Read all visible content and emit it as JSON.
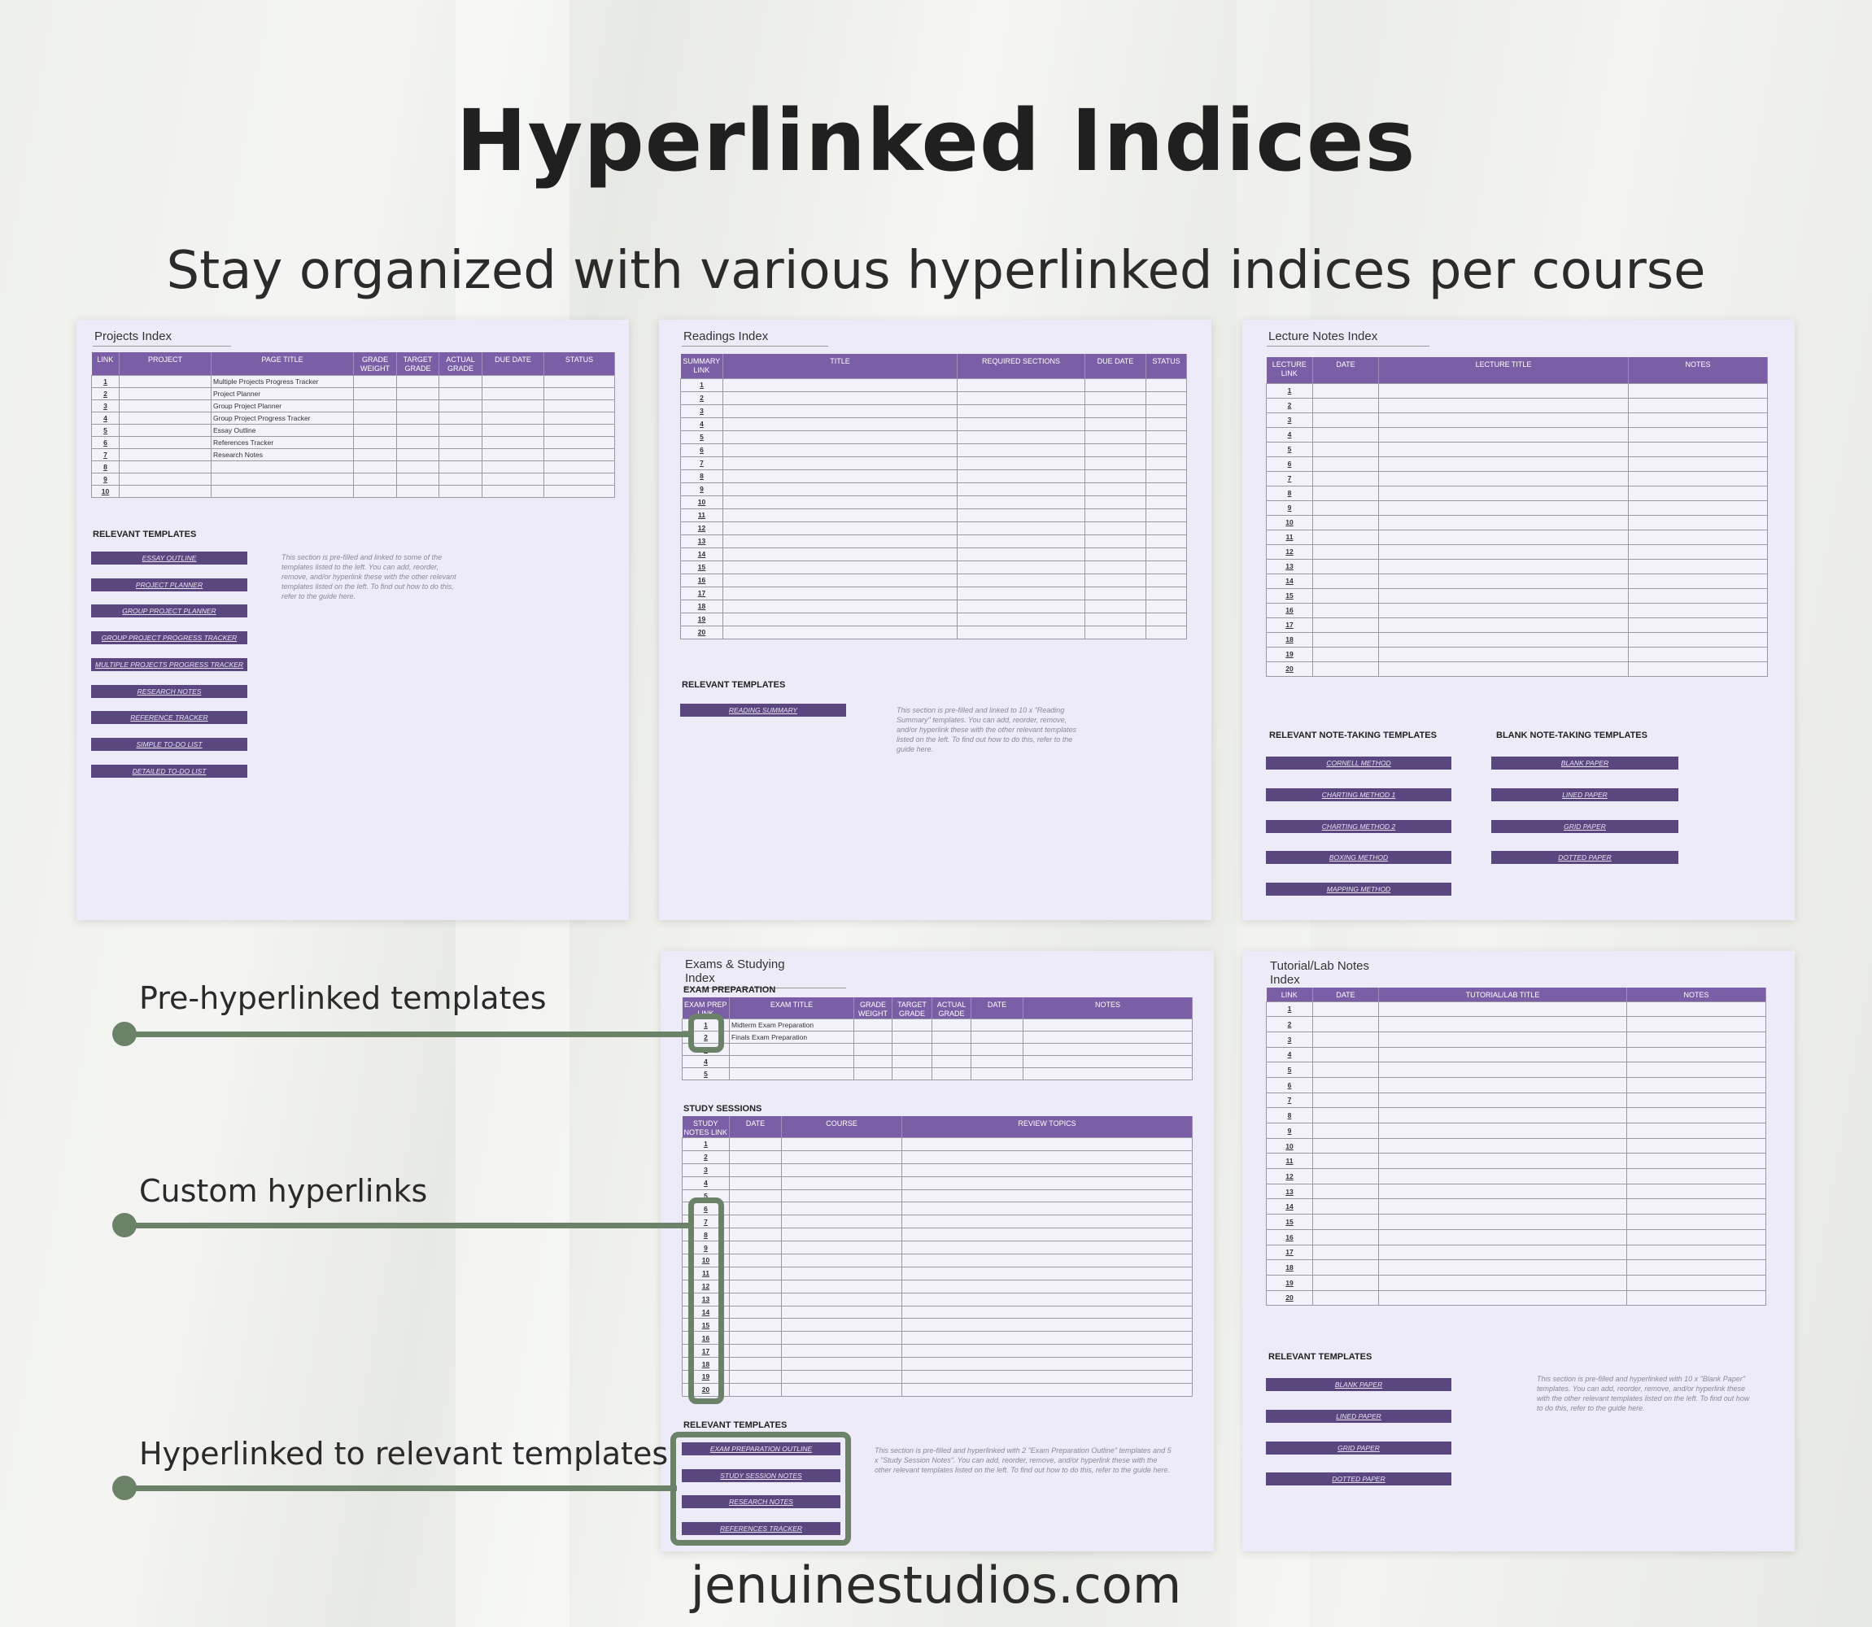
{
  "heading": {
    "title": "Hyperlinked Indices",
    "subtitle": "Stay organized with various hyperlinked indices per course",
    "footer": "jenuinestudios.com"
  },
  "colors": {
    "accent": "#7b5fa6",
    "button": "#5b4780",
    "callout": "#6b8269",
    "page_bg": "#eeebf8"
  },
  "projects": {
    "title": "Projects Index",
    "headers": [
      "LINK",
      "PROJECT",
      "PAGE TITLE",
      "GRADE WEIGHT",
      "TARGET GRADE",
      "ACTUAL GRADE",
      "DUE DATE",
      "STATUS"
    ],
    "rows": [
      [
        "1",
        "",
        "Multiple Projects Progress Tracker",
        "",
        "",
        "",
        "",
        ""
      ],
      [
        "2",
        "",
        "Project Planner",
        "",
        "",
        "",
        "",
        ""
      ],
      [
        "3",
        "",
        "Group Project Planner",
        "",
        "",
        "",
        "",
        ""
      ],
      [
        "4",
        "",
        "Group Project Progress Tracker",
        "",
        "",
        "",
        "",
        ""
      ],
      [
        "5",
        "",
        "Essay Outline",
        "",
        "",
        "",
        "",
        ""
      ],
      [
        "6",
        "",
        "References Tracker",
        "",
        "",
        "",
        "",
        ""
      ],
      [
        "7",
        "",
        "Research Notes",
        "",
        "",
        "",
        "",
        ""
      ],
      [
        "8",
        "",
        "",
        "",
        "",
        "",
        "",
        ""
      ],
      [
        "9",
        "",
        "",
        "",
        "",
        "",
        "",
        ""
      ],
      [
        "10",
        "",
        "",
        "",
        "",
        "",
        "",
        ""
      ]
    ],
    "section_label": "RELEVANT TEMPLATES",
    "buttons": [
      "ESSAY OUTLINE",
      "PROJECT PLANNER",
      "GROUP PROJECT PLANNER",
      "GROUP PROJECT PROGRESS TRACKER",
      "MULTIPLE PROJECTS PROGRESS TRACKER",
      "RESEARCH NOTES",
      "REFERENCE TRACKER",
      "SIMPLE TO-DO LIST",
      "DETAILED TO-DO LIST"
    ],
    "note": "This section is pre-filled and linked to some of the templates listed to the left. You can add, reorder, remove, and/or hyperlink these with the other relevant templates listed on the left. To find out how to do this, refer to the guide here."
  },
  "readings": {
    "title": "Readings Index",
    "headers": [
      "SUMMARY LINK",
      "TITLE",
      "REQUIRED SECTIONS",
      "DUE DATE",
      "STATUS"
    ],
    "rows": [
      "1",
      "2",
      "3",
      "4",
      "5",
      "6",
      "7",
      "8",
      "9",
      "10",
      "11",
      "12",
      "13",
      "14",
      "15",
      "16",
      "17",
      "18",
      "19",
      "20"
    ],
    "section_label": "RELEVANT TEMPLATES",
    "buttons": [
      "READING SUMMARY"
    ],
    "note": "This section is pre-filled and linked to 10 x \"Reading Summary\" templates. You can add, reorder, remove, and/or hyperlink these with the other relevant templates listed on the left. To find out how to do this, refer to the guide here."
  },
  "lectures": {
    "title": "Lecture Notes Index",
    "headers": [
      "LECTURE LINK",
      "DATE",
      "LECTURE TITLE",
      "NOTES"
    ],
    "rows": [
      "1",
      "2",
      "3",
      "4",
      "5",
      "6",
      "7",
      "8",
      "9",
      "10",
      "11",
      "12",
      "13",
      "14",
      "15",
      "16",
      "17",
      "18",
      "19",
      "20"
    ],
    "section_label_left": "RELEVANT NOTE-TAKING TEMPLATES",
    "section_label_right": "BLANK NOTE-TAKING TEMPLATES",
    "buttons_left": [
      "CORNELL METHOD",
      "CHARTING METHOD 1",
      "CHARTING METHOD 2",
      "BOXING METHOD",
      "MAPPING METHOD"
    ],
    "buttons_right": [
      "BLANK PAPER",
      "LINED PAPER",
      "GRID PAPER",
      "DOTTED PAPER"
    ]
  },
  "exams": {
    "title": "Exams & Studying Index",
    "exam_label": "EXAM PREPARATION",
    "exam_headers": [
      "EXAM PREP LINK",
      "EXAM TITLE",
      "GRADE WEIGHT",
      "TARGET GRADE",
      "ACTUAL GRADE",
      "DATE",
      "NOTES"
    ],
    "exam_rows": [
      [
        "1",
        "Midterm Exam Preparation",
        "",
        "",
        "",
        "",
        ""
      ],
      [
        "2",
        "Finals Exam Preparation",
        "",
        "",
        "",
        "",
        ""
      ],
      [
        "3",
        "",
        "",
        "",
        "",
        "",
        ""
      ],
      [
        "4",
        "",
        "",
        "",
        "",
        "",
        ""
      ],
      [
        "5",
        "",
        "",
        "",
        "",
        "",
        ""
      ]
    ],
    "study_label": "STUDY SESSIONS",
    "study_headers": [
      "STUDY NOTES LINK",
      "DATE",
      "COURSE",
      "REVIEW TOPICS"
    ],
    "study_rows": [
      "1",
      "2",
      "3",
      "4",
      "5",
      "6",
      "7",
      "8",
      "9",
      "10",
      "11",
      "12",
      "13",
      "14",
      "15",
      "16",
      "17",
      "18",
      "19",
      "20"
    ],
    "section_label": "RELEVANT TEMPLATES",
    "buttons": [
      "EXAM PREPARATION OUTLINE",
      "STUDY SESSION NOTES",
      "RESEARCH NOTES",
      "REFERENCES TRACKER"
    ],
    "note": "This section is pre-filled and hyperlinked with 2 \"Exam Preparation Outline\" templates and 5 x \"Study Session Notes\". You can add, reorder, remove, and/or hyperlink these with the other relevant templates listed on the left. To find out how to do this, refer to the guide here."
  },
  "tutorials": {
    "title": "Tutorial/Lab Notes Index",
    "headers": [
      "LINK",
      "DATE",
      "TUTORIAL/LAB TITLE",
      "NOTES"
    ],
    "rows": [
      "1",
      "2",
      "3",
      "4",
      "5",
      "6",
      "7",
      "8",
      "9",
      "10",
      "11",
      "12",
      "13",
      "14",
      "15",
      "16",
      "17",
      "18",
      "19",
      "20"
    ],
    "section_label": "RELEVANT TEMPLATES",
    "buttons": [
      "BLANK PAPER",
      "LINED PAPER",
      "GRID PAPER",
      "DOTTED PAPER"
    ],
    "note": "This section is pre-filled and hyperlinked with 10 x \"Blank Paper\" templates. You can add, reorder, remove, and/or hyperlink these with the other relevant templates listed on the left. To find out how to do this, refer to the guide here."
  },
  "callouts": [
    "Pre-hyperlinked templates",
    "Custom hyperlinks",
    "Hyperlinked to relevant templates"
  ]
}
